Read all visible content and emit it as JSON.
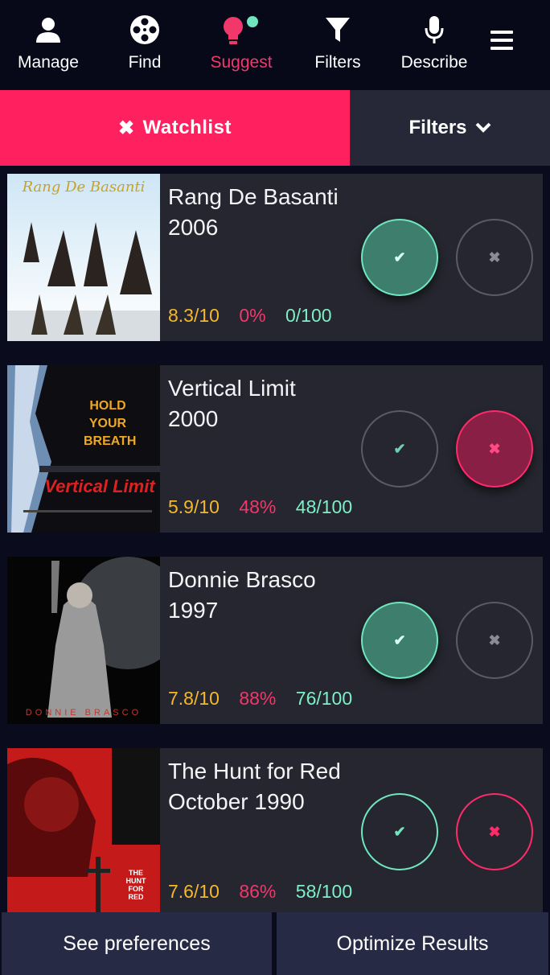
{
  "nav": {
    "items": [
      {
        "label": "Manage",
        "icon": "user-icon"
      },
      {
        "label": "Find",
        "icon": "film-reel-icon"
      },
      {
        "label": "Suggest",
        "icon": "lightbulb-icon"
      },
      {
        "label": "Filters",
        "icon": "funnel-icon"
      },
      {
        "label": "Describe",
        "icon": "microphone-icon"
      }
    ],
    "menu_icon": "hamburger-menu-icon"
  },
  "tabs": {
    "watchlist": "Watchlist",
    "filters": "Filters"
  },
  "movies": [
    {
      "title": "Rang De Basanti",
      "year": "2006",
      "rating": "8.3/10",
      "percent": "0%",
      "score": "0/100",
      "poster_text": "Rang De Basanti"
    },
    {
      "title": "Vertical Limit",
      "year": "2000",
      "rating": "5.9/10",
      "percent": "48%",
      "score": "48/100",
      "poster_text": "HOLD YOUR BREATH"
    },
    {
      "title": "Donnie Brasco",
      "year": "1997",
      "rating": "7.8/10",
      "percent": "88%",
      "score": "76/100",
      "poster_text": "DONNIE BRASCO"
    },
    {
      "title": "The Hunt for Red",
      "year": "October 1990",
      "rating": "7.6/10",
      "percent": "86%",
      "score": "58/100",
      "poster_text": "THE HUNT FOR RED"
    }
  ],
  "actions": {
    "check": "✔",
    "cross": "✖"
  },
  "bottom": {
    "preferences": "See preferences",
    "optimize": "Optimize Results"
  },
  "colors": {
    "accent": "#ff2060",
    "rating": "#f5b82b",
    "percent": "#f0386b",
    "score": "#7ff0c5"
  }
}
